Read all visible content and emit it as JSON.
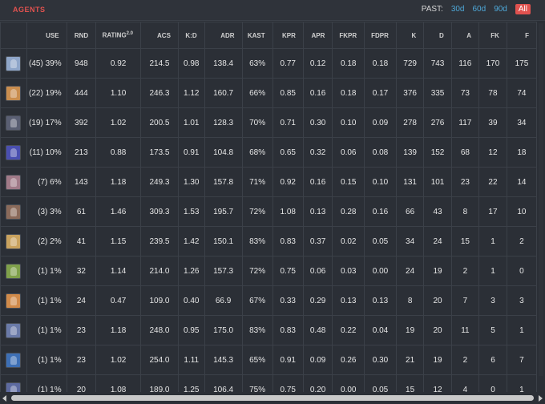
{
  "header": {
    "title": "AGENTS",
    "past_label": "PAST:",
    "options": [
      "30d",
      "60d",
      "90d",
      "All"
    ],
    "active_option": "All"
  },
  "table": {
    "columns": [
      "",
      "USE",
      "RND",
      "RATING",
      "ACS",
      "K:D",
      "ADR",
      "KAST",
      "KPR",
      "APR",
      "FKPR",
      "FDPR",
      "K",
      "D",
      "A",
      "FK",
      "F"
    ],
    "rating_superscript": "2.0",
    "rows": [
      {
        "avatar_color": "#8fa6c9",
        "use": "(45) 39%",
        "rnd": "948",
        "rating": "0.92",
        "acs": "214.5",
        "kd": "0.98",
        "adr": "138.4",
        "kast": "63%",
        "kpr": "0.77",
        "apr": "0.12",
        "fkpr": "0.18",
        "fdpr": "0.18",
        "k": "729",
        "d": "743",
        "a": "116",
        "fk": "170",
        "fd": "175"
      },
      {
        "avatar_color": "#c98d4e",
        "use": "(22) 19%",
        "rnd": "444",
        "rating": "1.10",
        "acs": "246.3",
        "kd": "1.12",
        "adr": "160.7",
        "kast": "66%",
        "kpr": "0.85",
        "apr": "0.16",
        "fkpr": "0.18",
        "fdpr": "0.17",
        "k": "376",
        "d": "335",
        "a": "73",
        "fk": "78",
        "fd": "74"
      },
      {
        "avatar_color": "#5a5f73",
        "use": "(19) 17%",
        "rnd": "392",
        "rating": "1.02",
        "acs": "200.5",
        "kd": "1.01",
        "adr": "128.3",
        "kast": "70%",
        "kpr": "0.71",
        "apr": "0.30",
        "fkpr": "0.10",
        "fdpr": "0.09",
        "k": "278",
        "d": "276",
        "a": "117",
        "fk": "39",
        "fd": "34"
      },
      {
        "avatar_color": "#4a4fb0",
        "use": "(11) 10%",
        "rnd": "213",
        "rating": "0.88",
        "acs": "173.5",
        "kd": "0.91",
        "adr": "104.8",
        "kast": "68%",
        "kpr": "0.65",
        "apr": "0.32",
        "fkpr": "0.06",
        "fdpr": "0.08",
        "k": "139",
        "d": "152",
        "a": "68",
        "fk": "12",
        "fd": "18"
      },
      {
        "avatar_color": "#a07a88",
        "use": "(7) 6%",
        "rnd": "143",
        "rating": "1.18",
        "acs": "249.3",
        "kd": "1.30",
        "adr": "157.8",
        "kast": "71%",
        "kpr": "0.92",
        "apr": "0.16",
        "fkpr": "0.15",
        "fdpr": "0.10",
        "k": "131",
        "d": "101",
        "a": "23",
        "fk": "22",
        "fd": "14"
      },
      {
        "avatar_color": "#8a6a5a",
        "use": "(3) 3%",
        "rnd": "61",
        "rating": "1.46",
        "acs": "309.3",
        "kd": "1.53",
        "adr": "195.7",
        "kast": "72%",
        "kpr": "1.08",
        "apr": "0.13",
        "fkpr": "0.28",
        "fdpr": "0.16",
        "k": "66",
        "d": "43",
        "a": "8",
        "fk": "17",
        "fd": "10"
      },
      {
        "avatar_color": "#c9a25e",
        "use": "(2) 2%",
        "rnd": "41",
        "rating": "1.15",
        "acs": "239.5",
        "kd": "1.42",
        "adr": "150.1",
        "kast": "83%",
        "kpr": "0.83",
        "apr": "0.37",
        "fkpr": "0.02",
        "fdpr": "0.05",
        "k": "34",
        "d": "24",
        "a": "15",
        "fk": "1",
        "fd": "2"
      },
      {
        "avatar_color": "#7fa04a",
        "use": "(1) 1%",
        "rnd": "32",
        "rating": "1.14",
        "acs": "214.0",
        "kd": "1.26",
        "adr": "157.3",
        "kast": "72%",
        "kpr": "0.75",
        "apr": "0.06",
        "fkpr": "0.03",
        "fdpr": "0.00",
        "k": "24",
        "d": "19",
        "a": "2",
        "fk": "1",
        "fd": "0"
      },
      {
        "avatar_color": "#d08a4a",
        "use": "(1) 1%",
        "rnd": "24",
        "rating": "0.47",
        "acs": "109.0",
        "kd": "0.40",
        "adr": "66.9",
        "kast": "67%",
        "kpr": "0.33",
        "apr": "0.29",
        "fkpr": "0.13",
        "fdpr": "0.13",
        "k": "8",
        "d": "20",
        "a": "7",
        "fk": "3",
        "fd": "3"
      },
      {
        "avatar_color": "#6a7aa8",
        "use": "(1) 1%",
        "rnd": "23",
        "rating": "1.18",
        "acs": "248.0",
        "kd": "0.95",
        "adr": "175.0",
        "kast": "83%",
        "kpr": "0.83",
        "apr": "0.48",
        "fkpr": "0.22",
        "fdpr": "0.04",
        "k": "19",
        "d": "20",
        "a": "11",
        "fk": "5",
        "fd": "1"
      },
      {
        "avatar_color": "#3d6fb5",
        "use": "(1) 1%",
        "rnd": "23",
        "rating": "1.02",
        "acs": "254.0",
        "kd": "1.11",
        "adr": "145.3",
        "kast": "65%",
        "kpr": "0.91",
        "apr": "0.09",
        "fkpr": "0.26",
        "fdpr": "0.30",
        "k": "21",
        "d": "19",
        "a": "2",
        "fk": "6",
        "fd": "7"
      },
      {
        "avatar_color": "#5d6aa0",
        "use": "(1) 1%",
        "rnd": "20",
        "rating": "1.08",
        "acs": "189.0",
        "kd": "1.25",
        "adr": "106.4",
        "kast": "75%",
        "kpr": "0.75",
        "apr": "0.20",
        "fkpr": "0.00",
        "fdpr": "0.05",
        "k": "15",
        "d": "12",
        "a": "4",
        "fk": "0",
        "fd": "1"
      }
    ]
  }
}
